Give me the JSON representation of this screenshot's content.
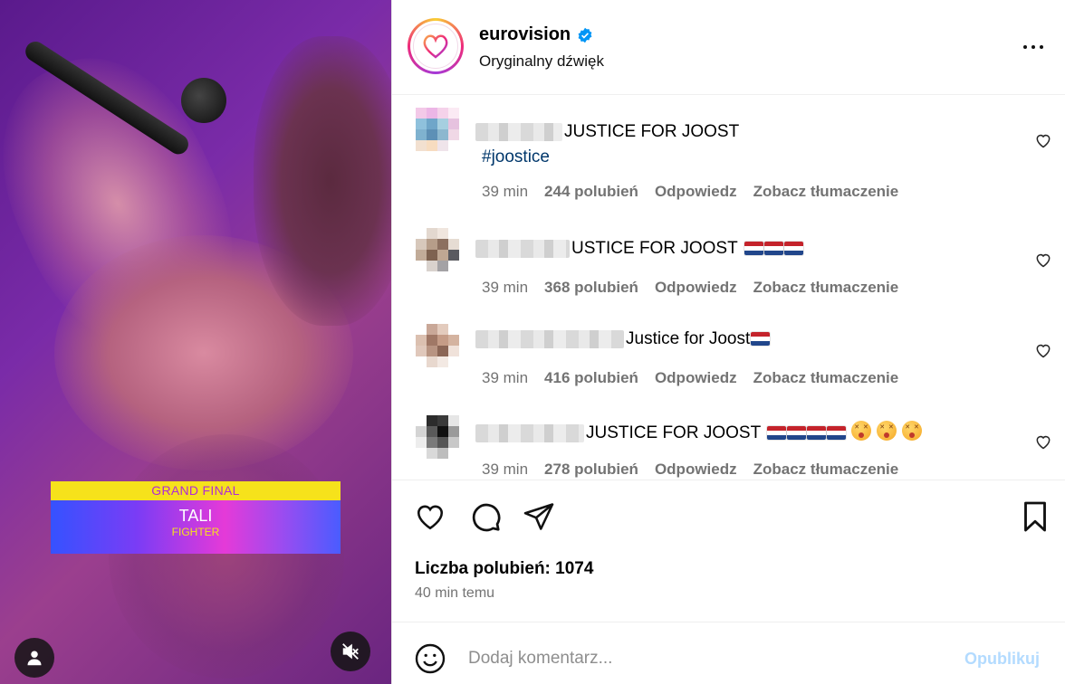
{
  "video": {
    "lower_third": {
      "round": "GRAND FINAL",
      "artist": "TALI",
      "song": "FIGHTER"
    },
    "user_button_icon": "user-icon",
    "mute_button_icon": "speaker-muted-icon"
  },
  "header": {
    "account_name": "eurovision",
    "verified": true,
    "audio_label": "Oryginalny dźwięk",
    "more_icon": "more-horizontal-icon"
  },
  "comments": [
    {
      "text": "JUSTICE FOR JOOST",
      "hashtag": "#joostice",
      "time": "39 min",
      "likes": "244 polubień",
      "reply": "Odpowiedz",
      "translate": "Zobacz tłumaczenie",
      "flags": 0,
      "emojis": 0
    },
    {
      "text": "USTICE FOR JOOST",
      "time": "39 min",
      "likes": "368 polubień",
      "reply": "Odpowiedz",
      "translate": "Zobacz tłumaczenie",
      "flags": 3,
      "emojis": 0
    },
    {
      "text": "Justice for Joost",
      "time": "39 min",
      "likes": "416 polubień",
      "reply": "Odpowiedz",
      "translate": "Zobacz tłumaczenie",
      "flags": 1,
      "emojis": 0
    },
    {
      "text": "JUSTICE FOR JOOST",
      "time": "39 min",
      "likes": "278 polubień",
      "reply": "Odpowiedz",
      "translate": "Zobacz tłumaczenie",
      "flags": 4,
      "emojis": 3
    }
  ],
  "actions": {
    "like_icon": "heart-icon",
    "comment_icon": "comment-icon",
    "share_icon": "paper-plane-icon",
    "save_icon": "bookmark-icon"
  },
  "stats": {
    "likes_label": "Liczba polubień: 1074",
    "time_ago": "40 min temu"
  },
  "add_comment": {
    "placeholder": "Dodaj komentarz...",
    "publish_label": "Opublikuj"
  },
  "colors": {
    "link": "#00376b",
    "muted_text": "#737373",
    "publish_disabled": "#b3dbff",
    "verified_blue": "#0095f6"
  }
}
